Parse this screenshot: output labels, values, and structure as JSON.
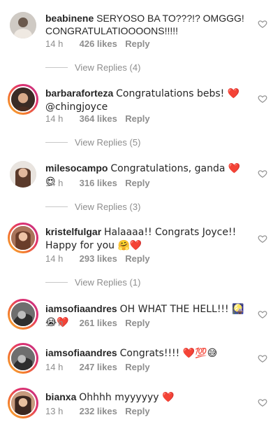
{
  "comments": [
    {
      "username": "beabinene",
      "text": "SERYOSO BA TO???!? OMGGG! CONGRATULATIOOOONS!!!!!",
      "time": "14 h",
      "likes": "426 likes",
      "reply": "Reply",
      "view_replies": "View Replies (4)"
    },
    {
      "username": "barbaraforteza",
      "text": "Congratulations bebs! ❤️ @chingjoyce",
      "time": "14 h",
      "likes": "364 likes",
      "reply": "Reply",
      "view_replies": "View Replies (5)"
    },
    {
      "username": "milesocampo",
      "text": "Congratulations, ganda ❤️😍",
      "time": "14 h",
      "likes": "316 likes",
      "reply": "Reply",
      "view_replies": "View Replies (3)"
    },
    {
      "username": "kristelfulgar",
      "text": "Halaaaa!! Congrats Joyce!! Happy for you 🤗❤️",
      "time": "14 h",
      "likes": "293 likes",
      "reply": "Reply",
      "view_replies": "View Replies (1)"
    },
    {
      "username": "iamsofiaandres",
      "text": "OH WHAT THE HELL!!! 🎑😭❤️",
      "time": "14 h",
      "likes": "261 likes",
      "reply": "Reply"
    },
    {
      "username": "iamsofiaandres",
      "text": "Congrats!!!! ❤️💯😅",
      "time": "14 h",
      "likes": "247 likes",
      "reply": "Reply"
    },
    {
      "username": "bianxa",
      "text": "Ohhhh myyyyyy ❤️",
      "time": "13 h",
      "likes": "232 likes",
      "reply": "Reply"
    }
  ],
  "icons": {
    "like": "heart-outline-icon",
    "avatar": "avatar"
  },
  "colors": {
    "text": "#262626",
    "muted": "#8e8e8e",
    "story_ring_start": "#f7b43c",
    "story_ring_end": "#c13584"
  }
}
